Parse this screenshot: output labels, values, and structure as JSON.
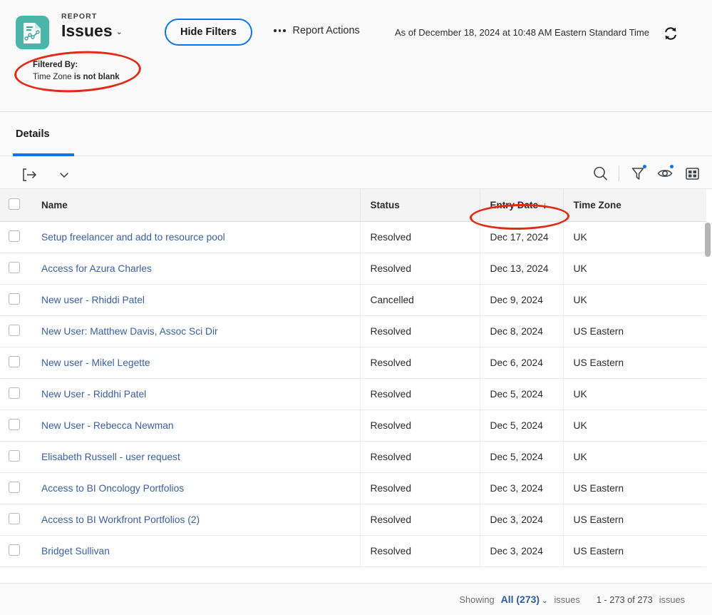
{
  "header": {
    "eyebrow": "REPORT",
    "title": "Issues",
    "title_caret": "⌄",
    "report_icon": "report-chart-icon",
    "icon_color": "#4bb5ac",
    "filtered_by_label": "Filtered By:",
    "filtered_by_field": "Time Zone ",
    "filtered_by_condition": "is not blank",
    "hide_filters_label": "Hide Filters",
    "report_actions_label": "Report Actions",
    "as_of": "As of December 18, 2024 at 10:48 AM Eastern Standard Time",
    "refresh_icon": "refresh-icon",
    "accent_color": "#1473e6"
  },
  "tabs": [
    {
      "label": "Details",
      "active": true
    }
  ],
  "toolbar": {
    "export_icon": "export-icon",
    "export_caret": "chevron-down-icon",
    "search_icon": "search-icon",
    "filter_icon": "filter-funnel-icon",
    "visibility_icon": "eye-icon",
    "layout_icon": "grid-layout-icon"
  },
  "table": {
    "select_all_checkbox": "unchecked",
    "columns": [
      {
        "label": "",
        "key": "check"
      },
      {
        "label": "Name",
        "key": "name"
      },
      {
        "label": "Status",
        "key": "status"
      },
      {
        "label": "Entry Date",
        "key": "entry_date",
        "sorted": "desc",
        "sort_glyph": "↓"
      },
      {
        "label": "Time Zone",
        "key": "time_zone"
      }
    ],
    "rows": [
      {
        "name": "Setup freelancer and add to resource pool",
        "status": "Resolved",
        "entry_date": "Dec 17, 2024",
        "time_zone": "UK"
      },
      {
        "name": "Access for Azura Charles",
        "status": "Resolved",
        "entry_date": "Dec 13, 2024",
        "time_zone": "UK"
      },
      {
        "name": "New user - Rhiddi Patel",
        "status": "Cancelled",
        "entry_date": "Dec 9, 2024",
        "time_zone": "UK"
      },
      {
        "name": "New User: Matthew Davis, Assoc Sci Dir",
        "status": "Resolved",
        "entry_date": "Dec 8, 2024",
        "time_zone": "US Eastern"
      },
      {
        "name": "New user - Mikel Legette",
        "status": "Resolved",
        "entry_date": "Dec 6, 2024",
        "time_zone": "US Eastern"
      },
      {
        "name": "New User - Riddhi Patel",
        "status": "Resolved",
        "entry_date": "Dec 5, 2024",
        "time_zone": "UK"
      },
      {
        "name": "New User - Rebecca Newman",
        "status": "Resolved",
        "entry_date": "Dec 5, 2024",
        "time_zone": "UK"
      },
      {
        "name": "Elisabeth Russell - user request",
        "status": "Resolved",
        "entry_date": "Dec 5, 2024",
        "time_zone": "UK"
      },
      {
        "name": "Access to BI Oncology Portfolios",
        "status": "Resolved",
        "entry_date": "Dec 3, 2024",
        "time_zone": "US Eastern"
      },
      {
        "name": "Access to BI Workfront Portfolios (2)",
        "status": "Resolved",
        "entry_date": "Dec 3, 2024",
        "time_zone": "US Eastern"
      },
      {
        "name": "Bridget Sullivan",
        "status": "Resolved",
        "entry_date": "Dec 3, 2024",
        "time_zone": "US Eastern"
      }
    ]
  },
  "footer": {
    "showing_label": "Showing",
    "all_count_label": "All (273)",
    "all_caret": "⌄",
    "issues_label": "issues",
    "range_label": "1 - 273 of 273",
    "range_suffix": "issues"
  },
  "annotations": [
    {
      "name": "filtered-by-highlight",
      "color": "#e02b17"
    },
    {
      "name": "entry-date-highlight",
      "color": "#e02b17"
    }
  ]
}
